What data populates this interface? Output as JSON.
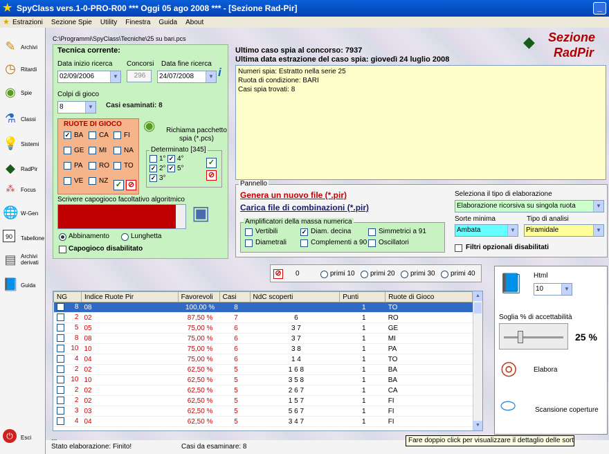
{
  "window": {
    "title": "SpyClass vers.1-0-PRO-R00  ***  Oggi 05 ago 2008  ***  - [Sezione Rad-Pir]"
  },
  "menu": [
    "Estrazioni",
    "Sezione Spie",
    "Utility",
    "Finestra",
    "Guida",
    "About"
  ],
  "sidebar": [
    {
      "label": "Archivi",
      "icon": "pencil-icon"
    },
    {
      "label": "Ritardi",
      "icon": "clock-icon"
    },
    {
      "label": "Spie",
      "icon": "flashlight-icon"
    },
    {
      "label": "Classi",
      "icon": "flask-icon"
    },
    {
      "label": "Sistemi",
      "icon": "bulb-icon"
    },
    {
      "label": "RadPir",
      "icon": "pyramid-icon"
    },
    {
      "label": "Focus",
      "icon": "focus-icon"
    },
    {
      "label": "W-Gen",
      "icon": "globe-icon"
    },
    {
      "label": "Tabellone",
      "icon": "calendar-icon"
    },
    {
      "label": "Archivi derivati",
      "icon": "archive-icon"
    },
    {
      "label": "Guida",
      "icon": "book-icon"
    },
    {
      "label": "Esci",
      "icon": "exit-icon"
    }
  ],
  "path": "C:\\Programmi\\SpyClass\\Tecniche\\25 su bari.pcs",
  "tecnica": {
    "title": "Tecnica corrente:",
    "data_inizio_label": "Data inizio ricerca",
    "data_inizio": "02/09/2006",
    "concorsi_label": "Concorsi",
    "concorsi": "296",
    "data_fine_label": "Data fine ricerca",
    "data_fine": "24/07/2008",
    "colpi_label": "Colpi di gioco",
    "colpi": "8",
    "casi_label": "Casi esaminati: 8"
  },
  "ruote": {
    "title": "RUOTE DI GIOCO",
    "items": [
      {
        "n": "BA",
        "c": true
      },
      {
        "n": "CA",
        "c": false
      },
      {
        "n": "FI",
        "c": false
      },
      {
        "n": "GE",
        "c": false
      },
      {
        "n": "MI",
        "c": false
      },
      {
        "n": "NA",
        "c": false
      },
      {
        "n": "PA",
        "c": false
      },
      {
        "n": "RO",
        "c": false
      },
      {
        "n": "TO",
        "c": false
      },
      {
        "n": "VE",
        "c": false
      },
      {
        "n": "NZ",
        "c": false
      }
    ]
  },
  "richiama": "Richiama pacchetto spia (*.pcs)",
  "determinato": {
    "title": "Determinato [345]",
    "items": [
      {
        "n": "1°",
        "c": false
      },
      {
        "n": "4°",
        "c": true
      },
      {
        "n": "2°",
        "c": true
      },
      {
        "n": "5°",
        "c": true
      },
      {
        "n": "3°",
        "c": true
      }
    ]
  },
  "capogioco": {
    "label": "Scrivere capogioco facoltativo algoritmico",
    "abbinamento": "Abbinamento",
    "lunghetta": "Lunghetta",
    "disabilitato": "Capogioco disabilitato"
  },
  "header": {
    "ultimo": "Ultimo caso spia al concorso: 7937",
    "ultima_data": "Ultima data estrazione del caso spia: giovedì 24 luglio 2008",
    "logo1": "Sezione",
    "logo2": "RadPir"
  },
  "info_lines": [
    "Numeri spia: Estratto nella serie 25",
    "Ruota di condizione: BARI",
    "Casi spia trovati: 8"
  ],
  "pannello": {
    "title": "Pannello",
    "genera": "Genera un nuovo file  (*.pir)",
    "carica": "Carica file di combinazioni  (*.pir)",
    "seleziona_label": "Seleziona il tipo di elaborazione",
    "seleziona": "Elaborazione ricorsiva su singola ruota",
    "sorte_label": "Sorte minima",
    "sorte": "Ambata",
    "tipo_label": "Tipo di analisi",
    "tipo": "Piramidale",
    "filtri": "Filtri opzionali disabilitati",
    "ampl_title": "Amplificatori della massa numerica",
    "ampl": [
      {
        "n": "Vertibili",
        "c": false
      },
      {
        "n": "Diam. decina",
        "c": true
      },
      {
        "n": "Simmetrici a 91",
        "c": false
      },
      {
        "n": "Diametrali",
        "c": false
      },
      {
        "n": "Complementi a 90",
        "c": false
      },
      {
        "n": "Oscillatori",
        "c": false
      }
    ]
  },
  "filterbar": {
    "count": "0",
    "options": [
      "primi 10",
      "primi 20",
      "primi 30",
      "primi 40"
    ]
  },
  "grid": {
    "headers": [
      "NG",
      "Indice Ruote Pir",
      "Favorevoli",
      "Casi",
      "NdC scoperti",
      "Punti",
      "Ruote di Gioco"
    ],
    "rows": [
      [
        "8",
        "08",
        "100,00 %",
        "8",
        "",
        "1",
        "TO"
      ],
      [
        "2",
        "02",
        "87,50 %",
        "7",
        "6",
        "1",
        "RO"
      ],
      [
        "5",
        "05",
        "75,00 %",
        "6",
        "3 7",
        "1",
        "GE"
      ],
      [
        "8",
        "08",
        "75,00 %",
        "6",
        "3 7",
        "1",
        "MI"
      ],
      [
        "10",
        "10",
        "75,00 %",
        "6",
        "3 8",
        "1",
        "PA"
      ],
      [
        "4",
        "04",
        "75,00 %",
        "6",
        "1 4",
        "1",
        "TO"
      ],
      [
        "2",
        "02",
        "62,50 %",
        "5",
        "1 6 8",
        "1",
        "BA"
      ],
      [
        "10",
        "10",
        "62,50 %",
        "5",
        "3 5 8",
        "1",
        "BA"
      ],
      [
        "2",
        "02",
        "62,50 %",
        "5",
        "2 6 7",
        "1",
        "CA"
      ],
      [
        "2",
        "02",
        "62,50 %",
        "5",
        "1 5 7",
        "1",
        "FI"
      ],
      [
        "3",
        "03",
        "62,50 %",
        "5",
        "5 6 7",
        "1",
        "FI"
      ],
      [
        "4",
        "04",
        "62,50 %",
        "5",
        "3 4 7",
        "1",
        "FI"
      ]
    ]
  },
  "right": {
    "html_label": "Html",
    "html_val": "10",
    "soglia_label": "Soglia % di accettabilità",
    "soglia_val": "25 %",
    "elabora": "Elabora",
    "scansione": "Scansione coperture"
  },
  "tooltip": "Fare doppio click per visualizzare il dettaglio delle sortite",
  "status": {
    "dots": "...",
    "stato": "Stato elaborazione:  Finito!",
    "casi": "Casi da esaminare: 8"
  }
}
